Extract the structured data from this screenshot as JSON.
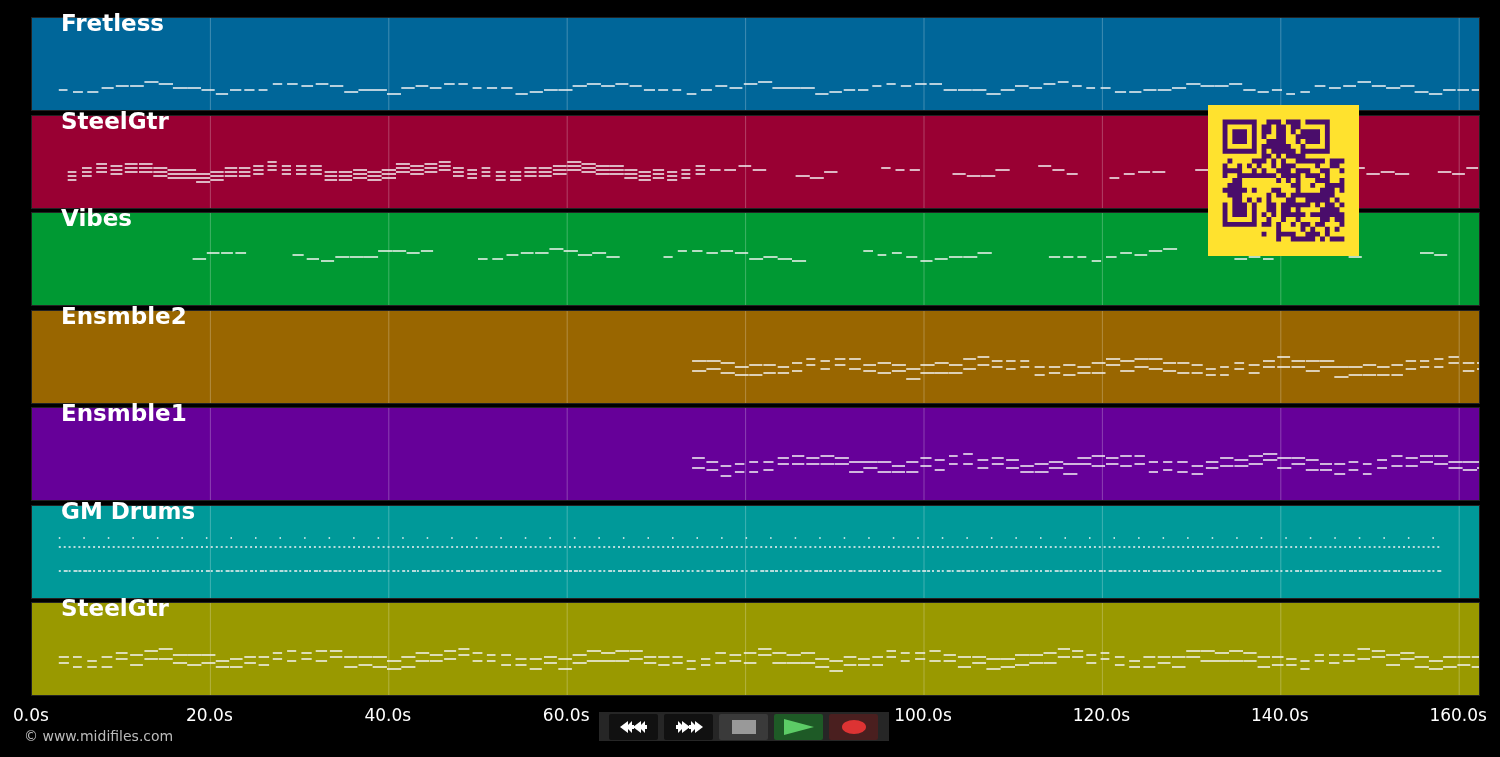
{
  "tracks": [
    {
      "name": "Fretless",
      "color": "#006699"
    },
    {
      "name": "SteelGtr",
      "color": "#990033"
    },
    {
      "name": "Vibes",
      "color": "#009933"
    },
    {
      "name": "Ensmble2",
      "color": "#996600"
    },
    {
      "name": "Ensmble1",
      "color": "#660099"
    },
    {
      "name": "GM Drums",
      "color": "#009999"
    },
    {
      "name": "SteelGtr",
      "color": "#999900"
    }
  ],
  "time_axis": {
    "ticks": [
      {
        "label": "0.0s",
        "covered": false
      },
      {
        "label": "20.0s",
        "covered": false
      },
      {
        "label": "40.0s",
        "covered": false
      },
      {
        "label": "60.0s",
        "covered": false
      },
      {
        "covered": true
      },
      {
        "label": "100.0s",
        "covered": false
      },
      {
        "label": "120.0s",
        "covered": false
      },
      {
        "label": "140.0s",
        "covered": false
      },
      {
        "label": "160.0s",
        "covered": false
      }
    ]
  },
  "copyright": "© www.midifiles.com",
  "transport": [
    {
      "kind": "rewind"
    },
    {
      "kind": "fast_forward"
    },
    {
      "kind": "stop"
    },
    {
      "kind": "play"
    },
    {
      "kind": "record"
    }
  ]
}
